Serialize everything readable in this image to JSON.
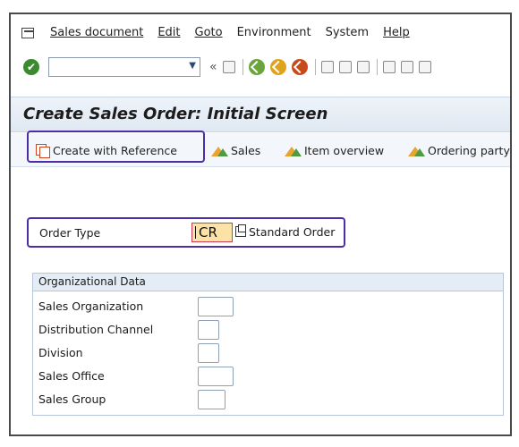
{
  "menubar": {
    "items": [
      "Sales document",
      "Edit",
      "Goto",
      "Environment",
      "System",
      "Help"
    ]
  },
  "toolbar": {
    "command_field_value": "",
    "nav_icons": [
      "back-icon",
      "exit-icon",
      "cancel-icon"
    ]
  },
  "title": "Create Sales Order: Initial Screen",
  "app_toolbar": {
    "create_with_reference": "Create with Reference",
    "sales": "Sales",
    "item_overview": "Item overview",
    "ordering_party": "Ordering party"
  },
  "order_type": {
    "label": "Order Type",
    "value": "CR",
    "description": "Standard Order"
  },
  "org_data": {
    "header": "Organizational Data",
    "fields": [
      {
        "label": "Sales Organization",
        "value": ""
      },
      {
        "label": "Distribution Channel",
        "value": ""
      },
      {
        "label": "Division",
        "value": ""
      },
      {
        "label": "Sales Office",
        "value": ""
      },
      {
        "label": "Sales Group",
        "value": ""
      }
    ]
  },
  "colors": {
    "highlight": "#4b2ea6",
    "title_bar": "#dfe8f2",
    "field_focus": "#fde2a8"
  }
}
